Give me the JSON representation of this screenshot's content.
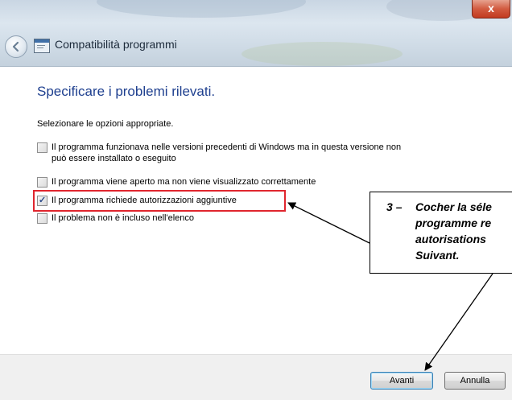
{
  "window": {
    "title": "Compatibilità programmi",
    "close_label": "x"
  },
  "main": {
    "heading": "Specificare i problemi rilevati.",
    "instruction": "Selezionare le opzioni appropriate.",
    "options": [
      {
        "label_line1": "Il programma funzionava nelle versioni precedenti di Windows ma in questa versione non",
        "label_line2": "può essere installato o eseguito",
        "checked": false
      },
      {
        "label_line1": "Il programma viene aperto ma non viene visualizzato correttamente",
        "label_line2": "",
        "checked": false
      },
      {
        "label_line1": "Il programma richiede autorizzazioni aggiuntive",
        "label_line2": "",
        "checked": true
      },
      {
        "label_line1": "Il problema non è incluso nell'elenco",
        "label_line2": "",
        "checked": false
      }
    ]
  },
  "annotation": {
    "number": "3",
    "dash": "–",
    "lines": [
      "Cocher la séle",
      "programme re",
      "autorisations",
      "Suivant."
    ],
    "highlight_color": "#e0262e"
  },
  "footer": {
    "next_label": "Avanti",
    "cancel_label": "Annulla"
  },
  "colors": {
    "heading": "#1e3f8f",
    "titlebar": "#cfdbe6",
    "close_button": "#d25b40"
  }
}
